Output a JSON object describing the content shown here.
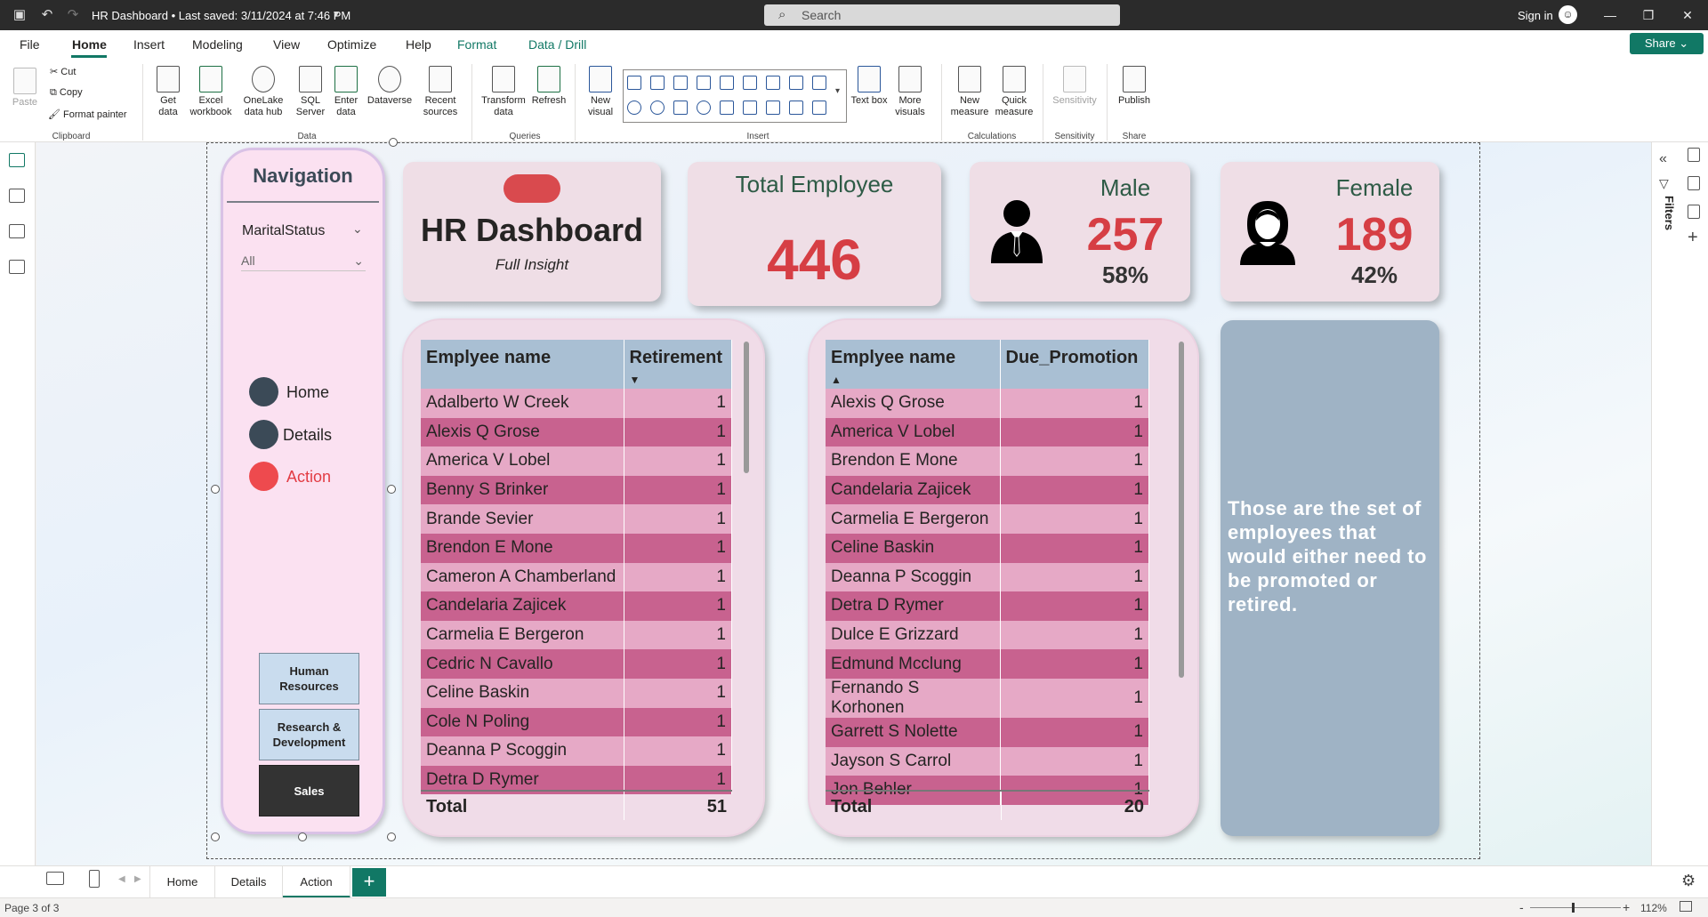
{
  "titlebar": {
    "title": "HR Dashboard • Last saved: 3/11/2024 at 7:46 PM",
    "search_placeholder": "Search",
    "signin": "Sign in"
  },
  "menu": {
    "items": [
      "File",
      "Home",
      "Insert",
      "Modeling",
      "View",
      "Optimize",
      "Help",
      "Format",
      "Data / Drill"
    ],
    "share": "Share"
  },
  "ribbon": {
    "paste": "Paste",
    "cut": "Cut",
    "copy": "Copy",
    "format_painter": "Format painter",
    "clipboard_group": "Clipboard",
    "get_data": "Get data",
    "excel": "Excel workbook",
    "onelake": "OneLake data hub",
    "sql": "SQL Server",
    "enter_data": "Enter data",
    "dataverse": "Dataverse",
    "recent": "Recent sources",
    "data_group": "Data",
    "transform": "Transform data",
    "refresh": "Refresh",
    "queries_group": "Queries",
    "new_visual": "New visual",
    "insert_group": "Insert",
    "text_box": "Text box",
    "more_visuals": "More visuals",
    "new_measure": "New measure",
    "quick_measure": "Quick measure",
    "calc_group": "Calculations",
    "sensitivity": "Sensitivity",
    "sensitivity_group": "Sensitivity",
    "publish": "Publish",
    "share_group": "Share"
  },
  "nav": {
    "title": "Navigation",
    "slicer_label": "MaritalStatus",
    "slicer_value": "All",
    "links": [
      "Home",
      "Details",
      "Action"
    ],
    "departments": [
      "Human Resources",
      "Research & Development",
      "Sales"
    ]
  },
  "cards": {
    "title": "HR Dashboard",
    "subtitle": "Full Insight",
    "total_label": "Total Employee",
    "total_value": "446",
    "male_label": "Male",
    "male_value": "257",
    "male_pct": "58%",
    "female_label": "Female",
    "female_value": "189",
    "female_pct": "42%"
  },
  "retirement_table": {
    "headers": [
      "Emplyee name",
      "Retirement"
    ],
    "rows": [
      [
        "Adalberto W Creek",
        "1"
      ],
      [
        "Alexis Q Grose",
        "1"
      ],
      [
        "America V Lobel",
        "1"
      ],
      [
        "Benny S Brinker",
        "1"
      ],
      [
        "Brande Sevier",
        "1"
      ],
      [
        "Brendon E Mone",
        "1"
      ],
      [
        "Cameron A Chamberland",
        "1"
      ],
      [
        "Candelaria Zajicek",
        "1"
      ],
      [
        "Carmelia E Bergeron",
        "1"
      ],
      [
        "Cedric N Cavallo",
        "1"
      ],
      [
        "Celine Baskin",
        "1"
      ],
      [
        "Cole N Poling",
        "1"
      ],
      [
        "Deanna P Scoggin",
        "1"
      ],
      [
        "Detra D Rymer",
        "1"
      ]
    ],
    "total_label": "Total",
    "total_value": "51"
  },
  "promotion_table": {
    "headers": [
      "Emplyee name",
      "Due_Promotion"
    ],
    "rows": [
      [
        "Alexis Q Grose",
        "1"
      ],
      [
        "America V Lobel",
        "1"
      ],
      [
        "Brendon E Mone",
        "1"
      ],
      [
        "Candelaria Zajicek",
        "1"
      ],
      [
        "Carmelia E Bergeron",
        "1"
      ],
      [
        "Celine Baskin",
        "1"
      ],
      [
        "Deanna P Scoggin",
        "1"
      ],
      [
        "Detra D Rymer",
        "1"
      ],
      [
        "Dulce E Grizzard",
        "1"
      ],
      [
        "Edmund Mcclung",
        "1"
      ],
      [
        "Fernando S Korhonen",
        "1"
      ],
      [
        "Garrett S Nolette",
        "1"
      ],
      [
        "Jayson S Carrol",
        "1"
      ],
      [
        "Jon Behler",
        "1"
      ]
    ],
    "total_label": "Total",
    "total_value": "20"
  },
  "info": {
    "text": "Those are the set of employees that would either need to be promoted or retired."
  },
  "pages": {
    "tabs": [
      "Home",
      "Details",
      "Action"
    ],
    "add": "+"
  },
  "status": {
    "page": "Page 3 of 3",
    "zoom": "112%"
  },
  "right_pane": {
    "filters": "Filters"
  },
  "colors": {
    "accent": "#117865",
    "kpi_red": "#d63e44",
    "row_light": "#e6a9c6",
    "row_dark": "#c8628f",
    "header_blue": "#a9bfd3"
  }
}
